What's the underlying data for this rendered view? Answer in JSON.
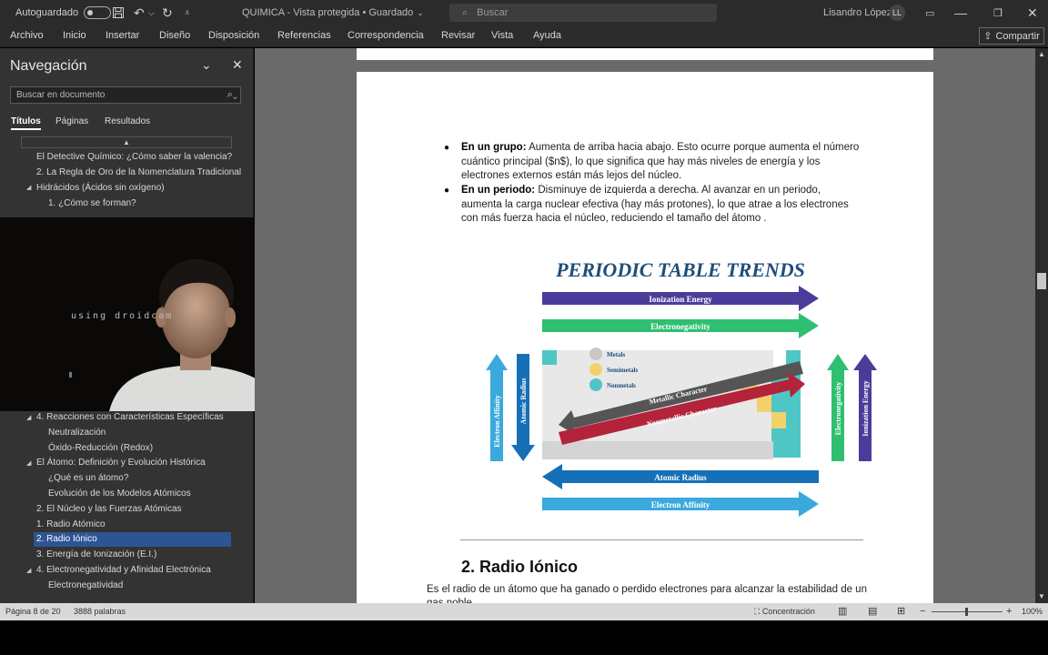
{
  "titlebar": {
    "autosave_label": "Autoguardado",
    "title": "QUIMICA  -  Vista protegida  •  Guardado",
    "search_placeholder": "Buscar",
    "user_name": "Lisandro López",
    "user_initials": "LL"
  },
  "ribbon": {
    "tabs": [
      "Archivo",
      "Inicio",
      "Insertar",
      "Diseño",
      "Disposición",
      "Referencias",
      "Correspondencia",
      "Revisar",
      "Vista",
      "Ayuda"
    ],
    "share_label": "Compartir"
  },
  "nav": {
    "title": "Navegación",
    "search_placeholder": "Buscar en documento",
    "tabs": [
      "Títulos",
      "Páginas",
      "Resultados"
    ],
    "headings": [
      "El Detective Químico: ¿Cómo saber la valencia?",
      "2. La Regla de Oro de la Nomenclatura Tradicional",
      "Hidrácidos (Ácidos sin oxígeno)",
      "1. ¿Cómo se forman?",
      "4. Reacciones con Características Específicas",
      "Neutralización",
      "Óxido-Reducción (Redox)",
      "El Átomo: Definición y Evolución Histórica",
      "¿Qué es un átomo?",
      "Evolución de los Modelos Atómicos",
      "2. El Núcleo y las Fuerzas Atómicas",
      "1. Radio Atómico",
      "2. Radio Iónico",
      "3. Energía de Ionización (E.I.)",
      "4. Electronegatividad y Afinidad Electrónica",
      "Electronegatividad"
    ]
  },
  "webcam": {
    "overlay_text": "using droidcam"
  },
  "document": {
    "bullet1_bold": "En un grupo:",
    "bullet1_text": " Aumenta de arriba hacia abajo. Esto ocurre porque aumenta el número cuántico principal ($n$), lo que significa que hay más niveles de energía y los electrones externos están más lejos del núcleo.",
    "bullet2_bold": "En un periodo:",
    "bullet2_text": " Disminuye de izquierda a derecha. Al avanzar en un periodo, aumenta la carga nuclear efectiva (hay más protones), lo que atrae a los electrones con más fuerza hacia el núcleo, reduciendo el tamaño del átomo .",
    "figure": {
      "title": "PERIODIC TABLE TRENDS",
      "arrows": [
        "Ionization Energy",
        "Electronegativity",
        "Atomic Radius",
        "Electron Affinity"
      ],
      "vertical_arrows": [
        "Electron Affinity",
        "Atomic Radius",
        "Electronegativity",
        "Ionization Energy"
      ],
      "diagonal_arrows": [
        "Metallic Character",
        "Nonmetallic Character"
      ],
      "legend": [
        "Metals",
        "Semimetals",
        "Nonmetals"
      ],
      "colors": {
        "title": "#1f4e79",
        "ionization": "#4a3d99",
        "electronegativity": "#2fbf71",
        "atomic_radius": "#1570b8",
        "electron_affinity": "#3aa9dc",
        "metallic": "#555555",
        "nonmetallic": "#b3233a",
        "metal": "#c8c8c8",
        "semimetal": "#f2d16b",
        "nonmetal": "#4fc6c6"
      }
    },
    "heading": "2. Radio Iónico",
    "body": "Es el radio de un átomo que ha ganado o perdido electrones para alcanzar la estabilidad de un gas noble."
  },
  "status": {
    "page": "Página 8 de 20",
    "words": "3888 palabras",
    "focus": "Concentración",
    "zoom": "100%"
  }
}
